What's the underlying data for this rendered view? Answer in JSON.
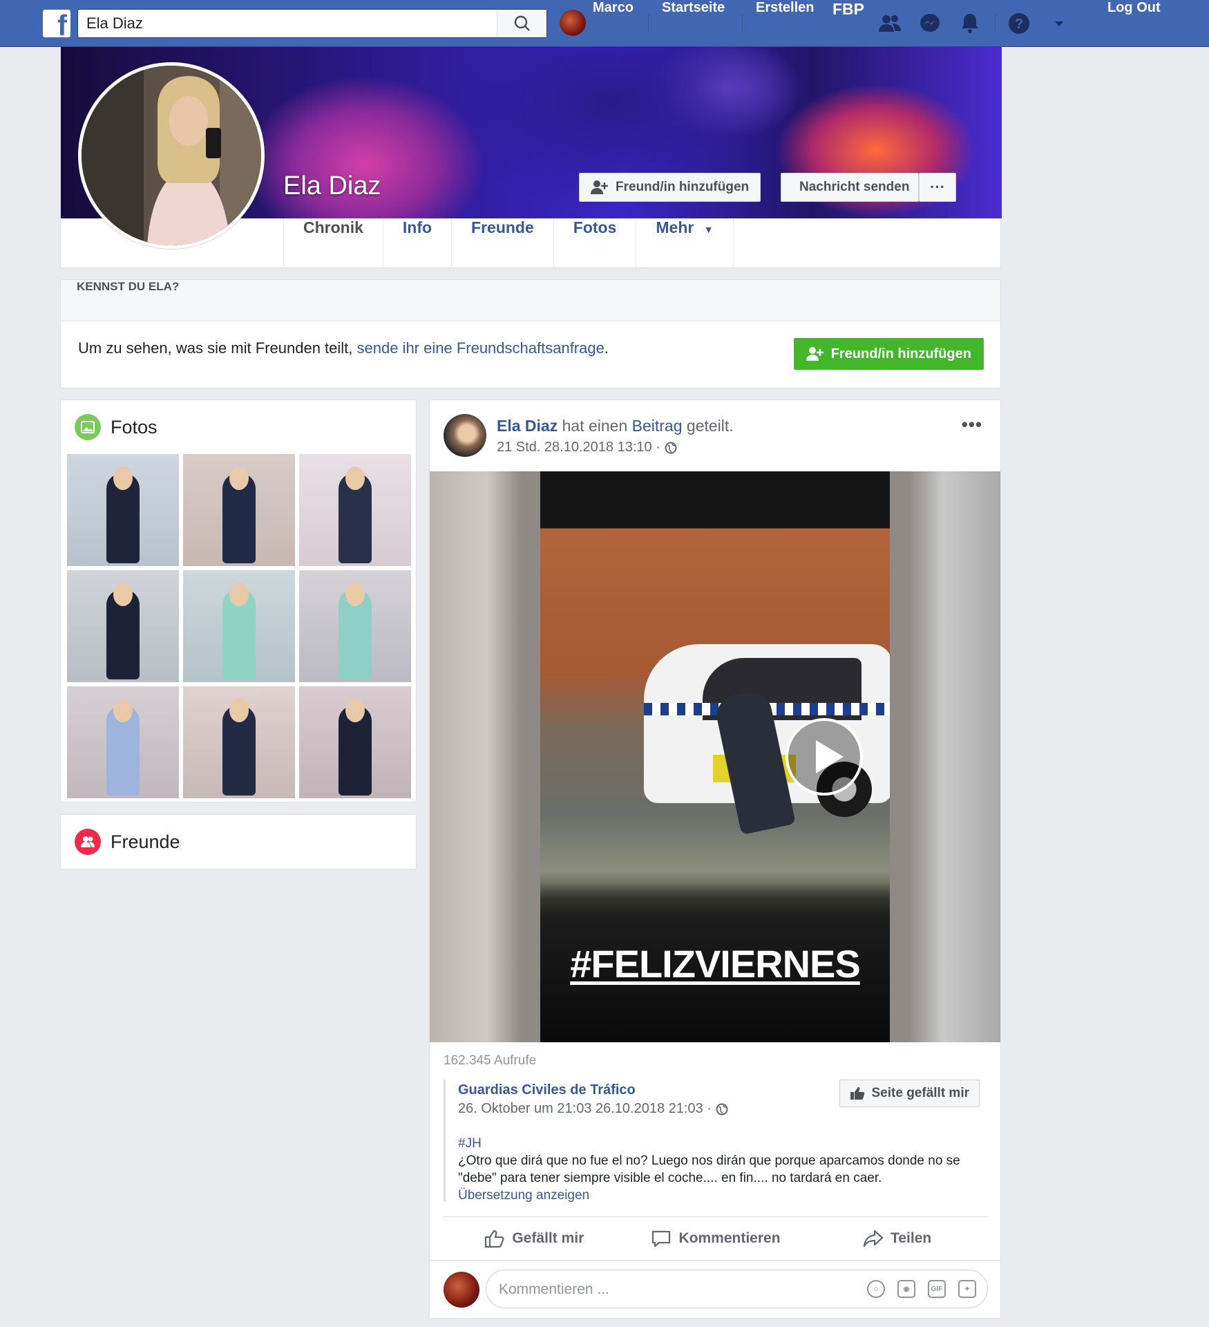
{
  "topbar": {
    "search_value": "Ela Diaz",
    "user_name": "Marco",
    "home": "Startseite",
    "create": "Erstellen",
    "fbp": "FBP",
    "logout": "Log Out",
    "brand_color": "#4267b2"
  },
  "profile": {
    "name": "Ela Diaz",
    "add_friend": "Freund/in hinzufügen",
    "send_message": "Nachricht senden",
    "more_dots": "···"
  },
  "tabs": {
    "timeline": "Chronik",
    "info": "Info",
    "friends": "Freunde",
    "photos": "Fotos",
    "more": "Mehr"
  },
  "know": {
    "heading": "KENNST DU ELA?",
    "text": "Um zu sehen, was sie mit Freunden teilt, ",
    "link": "sende ihr eine Freundschaftsanfrage",
    "period": ".",
    "button": "Freund/in hinzufügen",
    "button_color": "#42b72a"
  },
  "sidebar": {
    "photos_title": "Fotos",
    "friends_title": "Freunde"
  },
  "post": {
    "author": "Ela Diaz",
    "action_text": " hat einen ",
    "action_link": "Beitrag",
    "action_end": " geteilt.",
    "time": "21 Std. 28.10.2018 13:10 ·",
    "more": "•••",
    "video_caption": "#FELIZVIERNES",
    "views": "162.345 Aufrufe",
    "shared": {
      "page_name": "Guardias Civiles de Tráfico",
      "date": "26. Oktober um 21:03 26.10.2018 21:03 ·",
      "like_page": "Seite gefällt mir",
      "hashtag": "#JH",
      "text": "¿Otro que dirá que no fue el no? Luego nos dirán que porque aparcamos donde no se \"debe\" para tener siempre visible el coche.... en fin.... no tardará en caer.",
      "translate": "Übersetzung anzeigen"
    },
    "like": "Gefällt mir",
    "comment": "Kommentieren",
    "share": "Teilen",
    "comment_placeholder": "Kommentieren ...",
    "gif": "GIF"
  }
}
